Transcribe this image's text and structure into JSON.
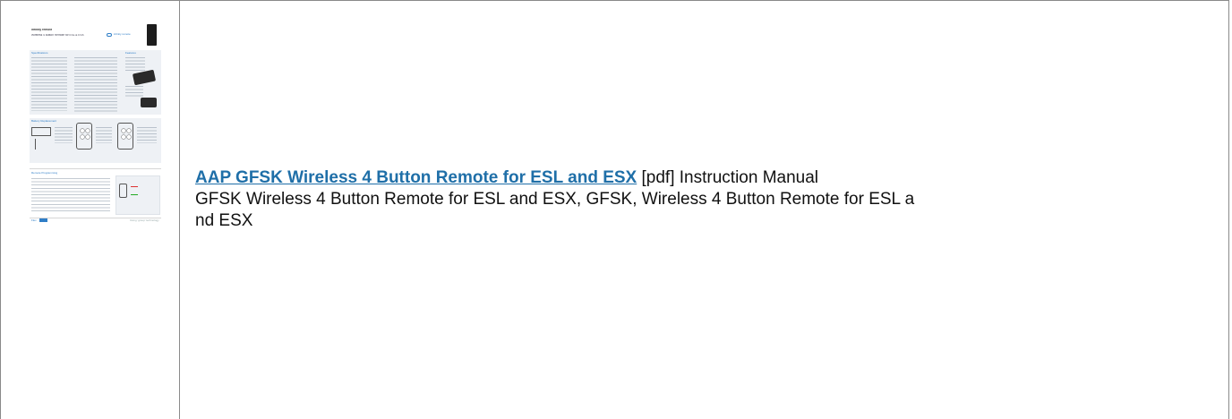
{
  "thumbnail": {
    "brand": "infinity remote",
    "heading": "Wireless 4 Button Remote for ESL & ESX",
    "logo_text": "infinity remote",
    "specs_title": "Specifications",
    "features_title": "Features",
    "battery_title": "Battery Replacement",
    "program_title": "Remote Programming",
    "footer_left": "Flex",
    "footer_right": "Using 'group' technology"
  },
  "document": {
    "title_link": "AAP GFSK Wireless 4 Button Remote for ESL and ESX",
    "pdf_label": "[pdf]",
    "doc_type": "Instruction Manual",
    "description_line1": "GFSK Wireless 4 Button Remote for ESL and ESX, GFSK, Wireless 4 Button Remote for ESL a",
    "description_line2": "nd ESX"
  }
}
